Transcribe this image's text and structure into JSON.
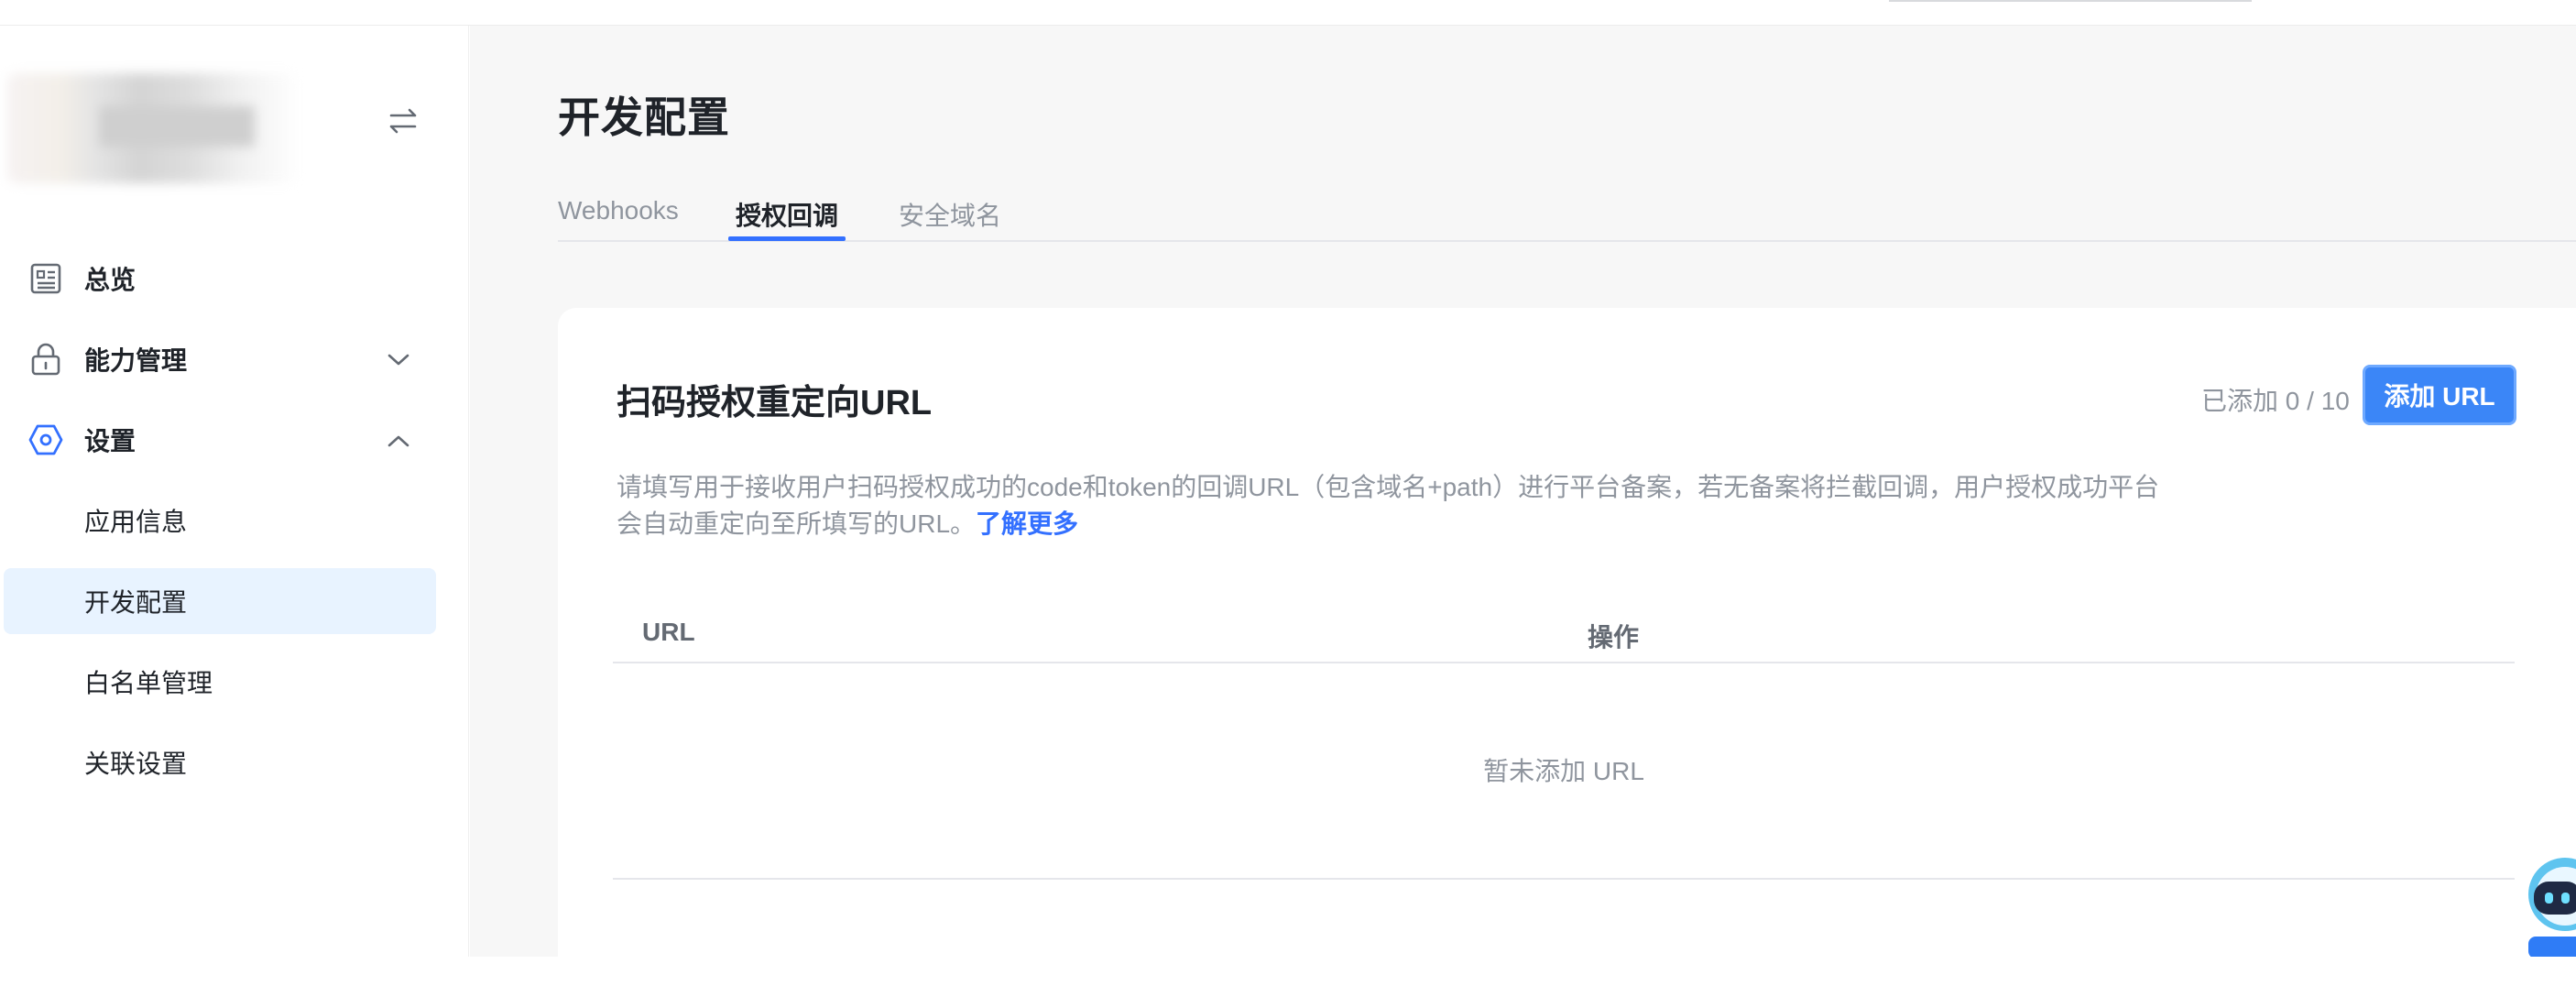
{
  "sidebar": {
    "nav": [
      {
        "label": "总览",
        "icon": "overview-icon"
      },
      {
        "label": "能力管理",
        "icon": "lock-icon",
        "expanded": false
      },
      {
        "label": "设置",
        "icon": "settings-icon",
        "expanded": true
      }
    ],
    "sub_items": [
      {
        "label": "应用信息",
        "active": false
      },
      {
        "label": "开发配置",
        "active": true
      },
      {
        "label": "白名单管理",
        "active": false
      },
      {
        "label": "关联设置",
        "active": false
      }
    ]
  },
  "main": {
    "page_title": "开发配置",
    "tabs": [
      {
        "label": "Webhooks",
        "active": false
      },
      {
        "label": "授权回调",
        "active": true
      },
      {
        "label": "安全域名",
        "active": false
      }
    ],
    "card": {
      "title": "扫码授权重定向URL",
      "added_count": "已添加 0 / 10",
      "add_button": "添加 URL",
      "description": "请填写用于接收用户扫码授权成功的code和token的回调URL（包含域名+path）进行平台备案，若无备案将拦截回调，用户授权成功平台会自动重定向至所填写的URL。",
      "learn_more": "了解更多",
      "table": {
        "columns": [
          "URL",
          "操作"
        ],
        "empty_text": "暂未添加 URL"
      }
    }
  },
  "colors": {
    "accent": "#3370ff",
    "button": "#3b86f7",
    "active_bg": "#e8f3ff",
    "page_bg": "#f7f7f7"
  }
}
